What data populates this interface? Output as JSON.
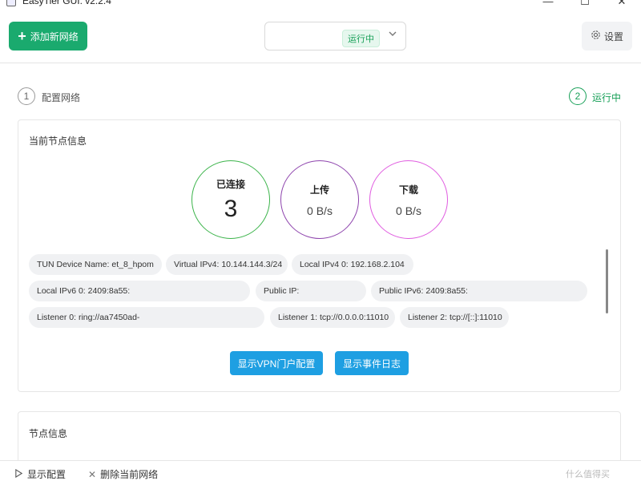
{
  "window": {
    "title": "EasyTier GUI: v2.2.4",
    "minimize": "—",
    "maximize": "☐",
    "close": "✕"
  },
  "toolbar": {
    "add_network_label": "添加新网络",
    "network_status_tag": "运行中",
    "settings_label": "设置"
  },
  "steps": [
    {
      "index": "1",
      "label": "配置网络"
    },
    {
      "index": "2",
      "label": "运行中"
    }
  ],
  "current_node": {
    "title": "当前节点信息",
    "stats": [
      {
        "title": "已连接",
        "value": "3",
        "color": "#3cb44b"
      },
      {
        "title": "上传",
        "value": "0 B/s",
        "color": "#8e44ad"
      },
      {
        "title": "下载",
        "value": "0 B/s",
        "color": "#e05ce0"
      }
    ],
    "info_rows": [
      [
        "TUN Device Name: et_8_hpom",
        "Virtual IPv4: 10.144.144.3/24",
        "Local IPv4 0: 192.168.2.104"
      ],
      [
        "Local IPv6 0: 2409:8a55:",
        "Public IP:",
        "Public IPv6: 2409:8a55:"
      ],
      [
        "Listener 0: ring://aa7450ad-",
        "Listener 1: tcp://0.0.0.0:11010",
        "Listener 2: tcp://[::]:11010"
      ]
    ],
    "buttons": {
      "show_vpn_portal": "显示VPN门户配置",
      "show_event_log": "显示事件日志"
    }
  },
  "peer_info": {
    "title": "节点信息"
  },
  "footer": {
    "show_config": "显示配置",
    "delete_network": "删除当前网络",
    "watermark": "什么值得买"
  },
  "colors": {
    "primary_green": "#1aaa6e",
    "accent_blue": "#1e9fe2"
  }
}
